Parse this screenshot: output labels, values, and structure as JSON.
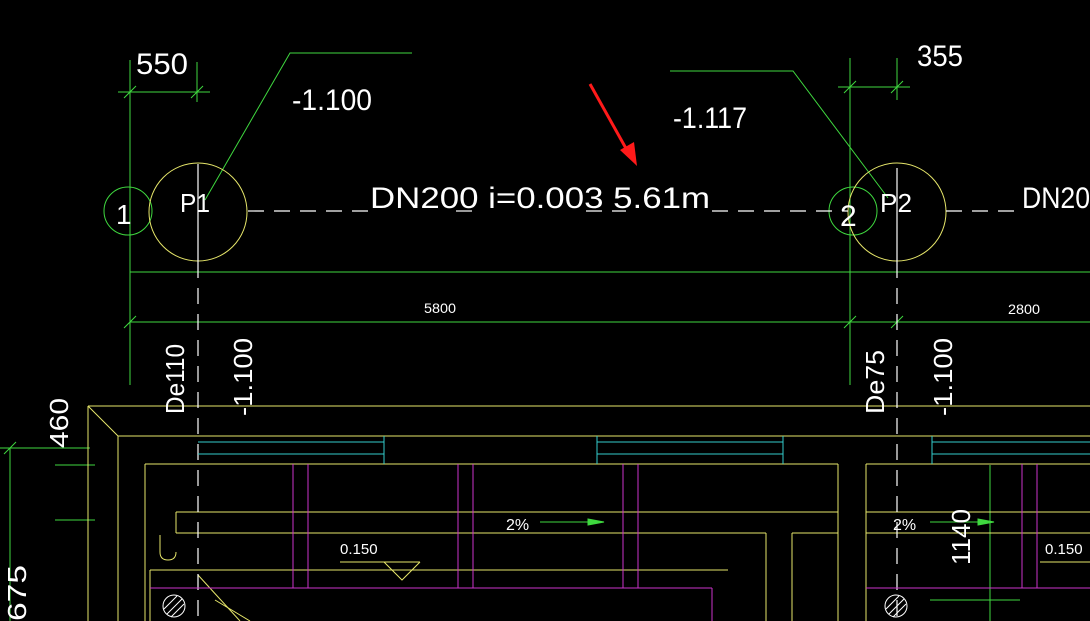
{
  "colors": {
    "background": "#000000",
    "green": "#3fd83f",
    "yellow": "#e6e66a",
    "white": "#ffffff",
    "cyan": "#33cccc",
    "magenta": "#cc33cc",
    "red": "#ff1a1a"
  },
  "dimensions": {
    "d1": "550",
    "d2": "355",
    "d3": "5800",
    "d4": "2800",
    "d5": "460",
    "d6": "675",
    "d7": "1140"
  },
  "elevations": {
    "e1": "-1.100",
    "e2": "-1.117",
    "e3": "-1.100",
    "e4": "-1.100"
  },
  "pipe": {
    "label": "DN200  i=0.003   5.61m",
    "label2": "DN20"
  },
  "manholes": {
    "p1": "P1",
    "p2": "P2"
  },
  "axes": {
    "a1": "1",
    "a2": "2"
  },
  "pipes_vertical": {
    "v1": "De110",
    "v2": "De75"
  },
  "slopes": {
    "s1": "2%",
    "s2": "2%"
  },
  "levels": {
    "l1": "0.150",
    "l2": "0.150"
  },
  "annotation": {
    "arrow_icon": "arrow-down-right-icon"
  }
}
